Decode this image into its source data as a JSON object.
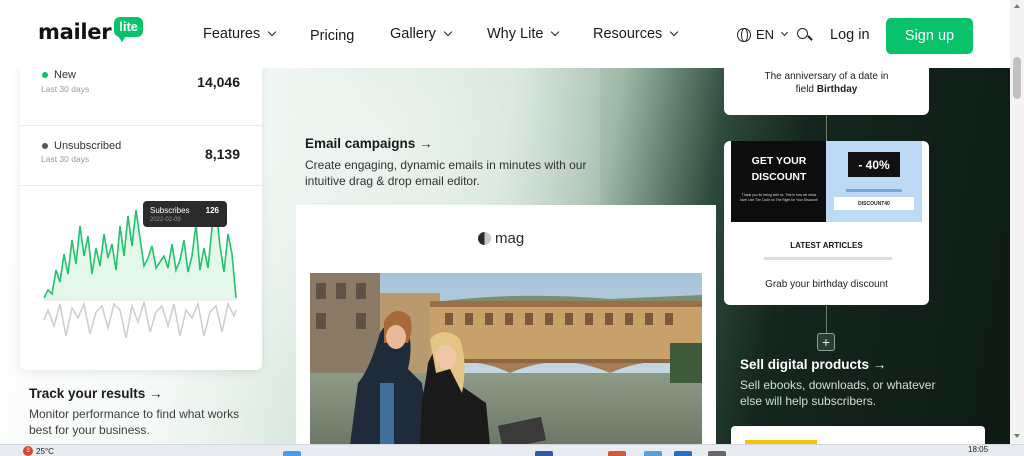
{
  "nav": {
    "logo_word": "mailer",
    "logo_badge": "lite",
    "menu": [
      {
        "label": "Features",
        "dropdown": true
      },
      {
        "label": "Pricing",
        "dropdown": false
      },
      {
        "label": "Gallery",
        "dropdown": true
      },
      {
        "label": "Why Lite",
        "dropdown": true
      },
      {
        "label": "Resources",
        "dropdown": true
      }
    ],
    "language": "EN",
    "login": "Log in",
    "signup": "Sign up"
  },
  "stats": {
    "new": {
      "label": "New",
      "sub": "Last 30 days",
      "value": "14,046",
      "color": "#09c269"
    },
    "unsubscribed": {
      "label": "Unsubscribed",
      "sub": "Last 30 days",
      "value": "8,139",
      "color": "#555555"
    },
    "tooltip": {
      "label": "Subscribes",
      "value": "126",
      "date": "2022-02-09"
    }
  },
  "track": {
    "title": "Track your results →",
    "desc": "Monitor performance to find what works best for your business."
  },
  "email_campaigns": {
    "title": "Email campaigns →",
    "desc": "Create engaging, dynamic emails in minutes with our intuitive drag & drop email editor.",
    "mag_logo": "mag"
  },
  "automation": {
    "anniversary_line1": "The anniversary of a date in",
    "anniversary_line2_prefix": "field",
    "anniversary_line2_bold": "Birthday",
    "promo_title_1": "GET YOUR",
    "promo_title_2": "DISCOUNT",
    "promo_small": "Thank you for being with us. This is how we show love! Use The Code on The Right for Your Discount!",
    "promo_pct": "- 40%",
    "promo_code": "DISCOUNT40",
    "latest": "LATEST ARTICLES",
    "birthday_caption": "Grab your birthday discount"
  },
  "digital": {
    "title": "Sell digital products →",
    "desc": "Sell ebooks, downloads, or whatever else will help subscribers."
  },
  "taskbar": {
    "badge": "3",
    "weather": "25°C",
    "time": "18:05"
  },
  "colors": {
    "brand_green": "#09c269",
    "dark_green": "#0d1b14"
  }
}
